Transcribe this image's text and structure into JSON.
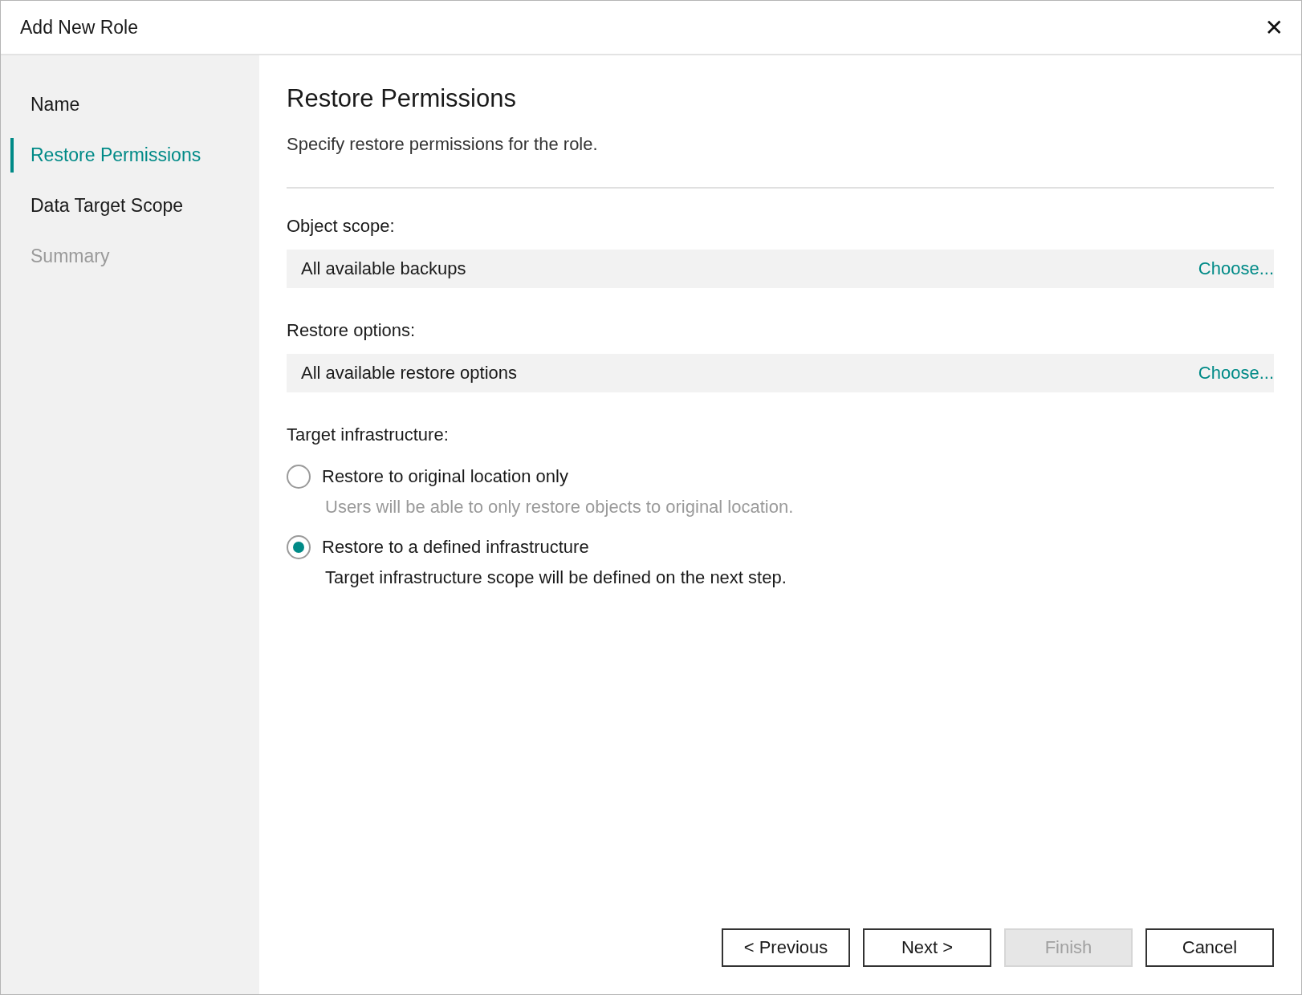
{
  "window": {
    "title": "Add New Role",
    "close": "✕"
  },
  "steps": [
    {
      "label": "Name",
      "selected": false,
      "disabled": false
    },
    {
      "label": "Restore Permissions",
      "selected": true,
      "disabled": false
    },
    {
      "label": "Data Target Scope",
      "selected": false,
      "disabled": false
    },
    {
      "label": "Summary",
      "selected": false,
      "disabled": true
    }
  ],
  "page": {
    "heading": "Restore Permissions",
    "description": "Specify restore permissions for the role."
  },
  "fields": [
    {
      "label": "Object scope:",
      "value": "All available backups",
      "link": "Choose..."
    },
    {
      "label": "Restore options:",
      "value": "All available restore options",
      "link": "Choose..."
    }
  ],
  "target": {
    "label": "Target infrastructure:",
    "options": [
      {
        "label": "Restore to original location only",
        "hint": "Users will be able to only restore objects to original location.",
        "selected": false
      },
      {
        "label": "Restore to a defined infrastructure",
        "hint": "Target infrastructure scope will be defined on the next step.",
        "selected": true
      }
    ]
  },
  "buttons": [
    {
      "label": "< Previous",
      "disabled": false
    },
    {
      "label": "Next >",
      "disabled": false
    },
    {
      "label": "Finish",
      "disabled": true
    },
    {
      "label": "Cancel",
      "disabled": false
    }
  ]
}
